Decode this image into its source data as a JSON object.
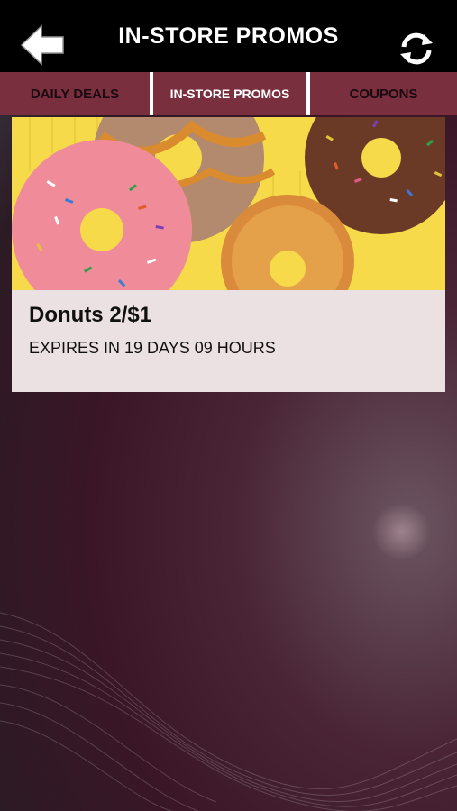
{
  "header": {
    "title": "IN-STORE PROMOS",
    "back_icon": "back-arrow-icon",
    "refresh_icon": "refresh-icon"
  },
  "tabs": [
    {
      "label": "DAILY DEALS",
      "active": false
    },
    {
      "label": "IN-STORE PROMOS",
      "active": true
    },
    {
      "label": "COUPONS",
      "active": false
    }
  ],
  "promo": {
    "name": "Donuts 2/$1",
    "expiry": "EXPIRES IN 19 DAYS 09 HOURS"
  },
  "colors": {
    "tab_background": "#7a2f3f",
    "header_background": "#000000",
    "image_background": "#f7de4f"
  }
}
